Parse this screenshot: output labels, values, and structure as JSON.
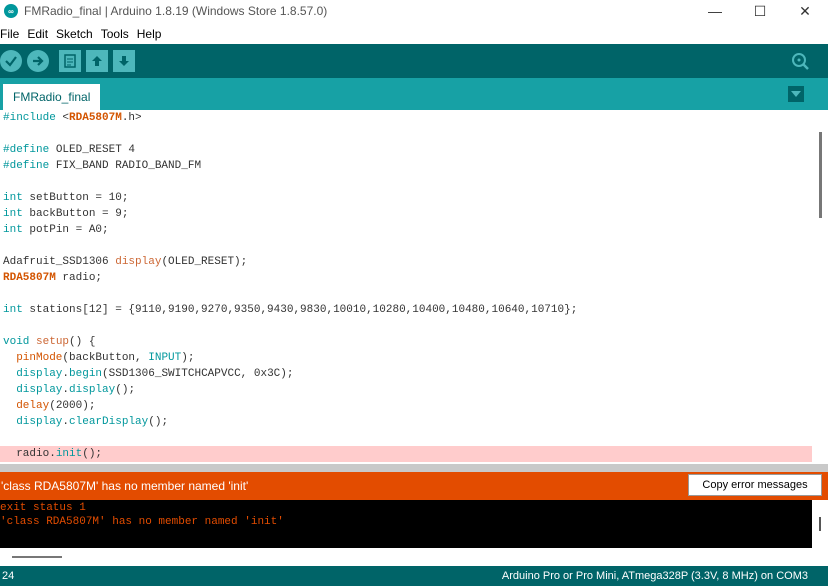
{
  "window": {
    "title": "FMRadio_final | Arduino 1.8.19 (Windows Store 1.8.57.0)",
    "minimize": "—",
    "maximize": "☐",
    "close": "✕"
  },
  "menu": [
    "File",
    "Edit",
    "Sketch",
    "Tools",
    "Help"
  ],
  "toolbar": {
    "verify": "verify-icon",
    "upload": "upload-icon",
    "new": "new-icon",
    "open": "open-icon",
    "save": "save-icon",
    "serial_monitor": "serial-monitor-icon"
  },
  "tab": {
    "label": "FMRadio_final"
  },
  "code": [
    "#include <RDA5807M.h>",
    "",
    "#define OLED_RESET 4",
    "#define FIX_BAND RADIO_BAND_FM",
    "",
    "int setButton = 10;",
    "int backButton = 9;",
    "int potPin = A0;",
    "",
    "Adafruit_SSD1306 display(OLED_RESET);",
    "RDA5807M radio;",
    "",
    "int stations[12] = {9110,9190,9270,9350,9430,9830,10010,10280,10400,10480,10640,10710};",
    "",
    "void setup() {",
    "  pinMode(backButton, INPUT);",
    "  display.begin(SSD1306_SWITCHCAPVCC, 0x3C);",
    "  display.display();",
    "  delay(2000);",
    "  display.clearDisplay();",
    "",
    "  radio.init();"
  ],
  "error": {
    "message": "'class RDA5807M' has no member named 'init'",
    "copy_button": "Copy error messages"
  },
  "console": [
    "exit status 1",
    "'class RDA5807M' has no member named 'init'"
  ],
  "status": {
    "line": "24",
    "board": "Arduino Pro or Pro Mini, ATmega328P (3.3V, 8 MHz) on COM3"
  },
  "colors": {
    "toolbar": "#006468",
    "tabbar": "#17a1a5",
    "error": "#e34c00",
    "highlight": "#ffcccc"
  }
}
